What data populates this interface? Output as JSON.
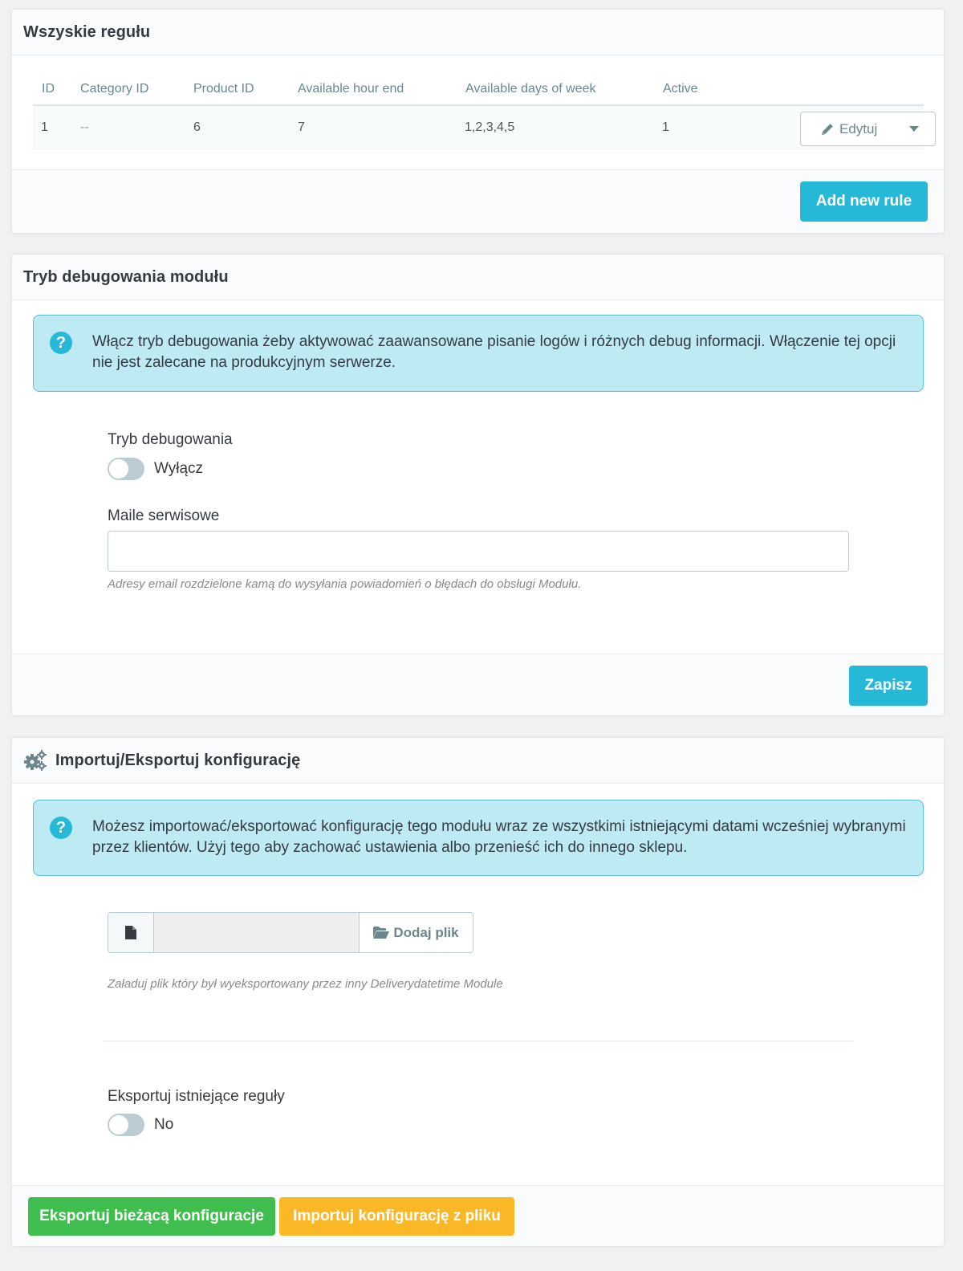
{
  "rules_panel": {
    "title": "Wszyskie regułu",
    "columns": [
      "ID",
      "Category ID",
      "Product ID",
      "Available hour end",
      "Available days of week",
      "Active"
    ],
    "rows": [
      {
        "id": "1",
        "category_id": "--",
        "product_id": "6",
        "hour_end": "7",
        "days": "1,2,3,4,5",
        "active": "1",
        "edit_label": "Edytuj"
      }
    ],
    "add_button": "Add new rule"
  },
  "debug_panel": {
    "title": "Tryb debugowania modułu",
    "alert": "Włącz tryb debugowania żeby aktywować zaawansowane pisanie logów i różnych debug informacji. Włączenie tej opcji nie jest zalecane na produkcyjnym serwerze.",
    "debug_label": "Tryb debugowania",
    "debug_switch_state": "Wyłącz",
    "debug_enabled": false,
    "emails_label": "Maile serwisowe",
    "emails_value": "",
    "emails_help": "Adresy email rozdzielone kamą do wysyłania powiadomień o błędach do obsługi Modułu.",
    "save_button": "Zapisz"
  },
  "import_panel": {
    "title": "Importuj/Eksportuj konfigurację",
    "alert": "Możesz importować/eksportować konfigurację tego modułu wraz ze wszystkimi istniejącymi datami wcześniej wybranymi przez klientów. Użyj tego aby zachować ustawienia albo przenieść ich do innego sklepu.",
    "file_value": "",
    "file_button": "Dodaj plik",
    "file_help": "Załaduj plik który był wyeksportowany przez inny Deliverydatetime Module",
    "export_rules_label": "Eksportuj istniejące reguły",
    "export_rules_state": "No",
    "export_rules_enabled": false,
    "export_button": "Eksportuj bieżącą konfiguracje",
    "import_button": "Importuj konfigurację z pliku"
  },
  "colors": {
    "info": "#25b9d7",
    "success": "#40bd4f",
    "warning": "#fab726",
    "alert_bg": "#beeaf3"
  }
}
